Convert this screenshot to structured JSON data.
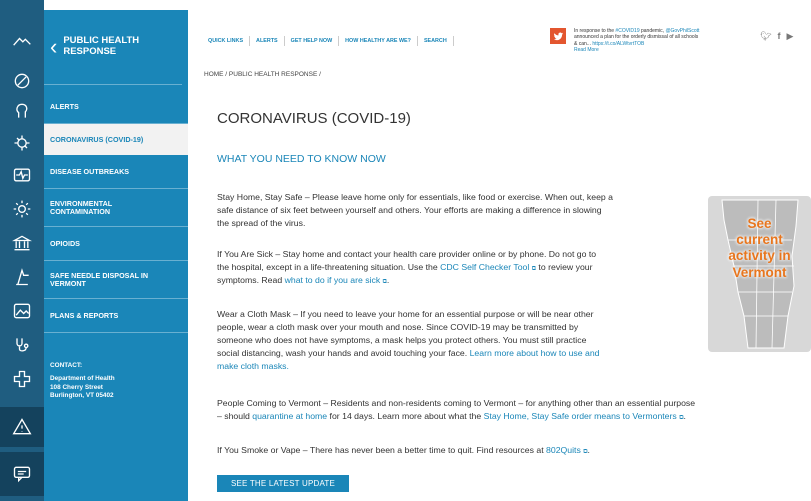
{
  "nav": {
    "header_title_line1": "PUBLIC HEALTH",
    "header_title_line2": "RESPONSE",
    "items": [
      {
        "label": "ALERTS"
      },
      {
        "label": "CORONAVIRUS (COVID-19)"
      },
      {
        "label": "DISEASE OUTBREAKS"
      },
      {
        "label_line1": "ENVIRONMENTAL",
        "label_line2": "CONTAMINATION"
      },
      {
        "label": "OPIOIDS"
      },
      {
        "label_line1": "SAFE NEEDLE DISPOSAL IN",
        "label_line2": "VERMONT"
      },
      {
        "label": "PLANS & REPORTS"
      }
    ],
    "contact": {
      "label": "CONTACT:",
      "line1": "Department of Health",
      "line2": "108 Cherry Street",
      "line3": "Burlington, VT 05402"
    }
  },
  "rail_icons": [
    "mountain-logo-icon",
    "ban-icon",
    "head-icon",
    "virus-icon",
    "heart-monitor-icon",
    "sun-icon",
    "building-icon",
    "hand-icon",
    "image-icon",
    "stethoscope-icon",
    "plus-icon",
    "warning-icon",
    "chat-icon"
  ],
  "topbar": {
    "links": [
      "QUICK LINKS",
      "ALERTS",
      "GET HELP NOW",
      "HOW HEALTHY ARE WE?",
      "SEARCH"
    ],
    "tweet_line1_prefix": "In response to the ",
    "tweet_hashtag": "#COVID19",
    "tweet_line1_mid": " pandemic, ",
    "tweet_handle": "@GovPhilScott",
    "tweet_line2": "announced a plan for the orderly dismissal of all schools",
    "tweet_line3_prefix": "& can... ",
    "tweet_url": "https://t.co/ALWtvrtTOB",
    "tweet_read_more": "Read More"
  },
  "breadcrumb": "HOME / PUBLIC HEALTH RESPONSE /",
  "page_title": "CORONAVIRUS (COVID-19)",
  "section_title": "WHAT YOU NEED TO KNOW NOW",
  "p1": {
    "l1": "Stay Home, Stay Safe – Please leave home only for essentials, like food or exercise. When out, keep a",
    "l2": "safe distance of six feet between yourself and others. Your efforts are making a difference in slowing",
    "l3": "the spread of the virus."
  },
  "p2": {
    "l1": "If You Are Sick – Stay home and contact your health care provider online or by phone. Do not go to",
    "l2a": "the hospital, except in a life-threatening situation. Use the ",
    "l2_link": "CDC Self Checker Tool",
    "l2b": " to review your",
    "l3a": "symptoms. Read ",
    "l3_link": "what to do if you are sick"
  },
  "p3": {
    "l1": "Wear a Cloth Mask – If you need to leave your home for an essential purpose or will be near other",
    "l2": "people, wear a cloth mask over your mouth and nose. Since COVID-19 may be transmitted by",
    "l3": "someone who does not have symptoms, a mask helps you protect others. You must still practice",
    "l4a": "social distancing, wash your hands and avoid touching your face. ",
    "l4_link": "Learn more about how to use and",
    "l5_link": "make cloth masks."
  },
  "p4": {
    "l1": "People Coming to Vermont – Residents and non-residents coming to Vermont – for anything other than an essential purpose",
    "l2a": "– should ",
    "l2_link1": "quarantine at home",
    "l2b": " for 14 days. Learn more about what the ",
    "l2_link2": "Stay Home, Stay Safe order means to Vermonters"
  },
  "p5": {
    "l1a": "If You Smoke or Vape – There has never been a better time to quit. Find resources at ",
    "l1_link": "802Quits"
  },
  "map_card": {
    "line1": "See",
    "line2": "current",
    "line3": "activity in",
    "line4": "Vermont"
  },
  "cta_label": "SEE THE LATEST UPDATE",
  "colors": {
    "brand_blue": "#1a86b8",
    "rail_blue": "#1f5d80",
    "accent_orange": "#e8761e"
  }
}
